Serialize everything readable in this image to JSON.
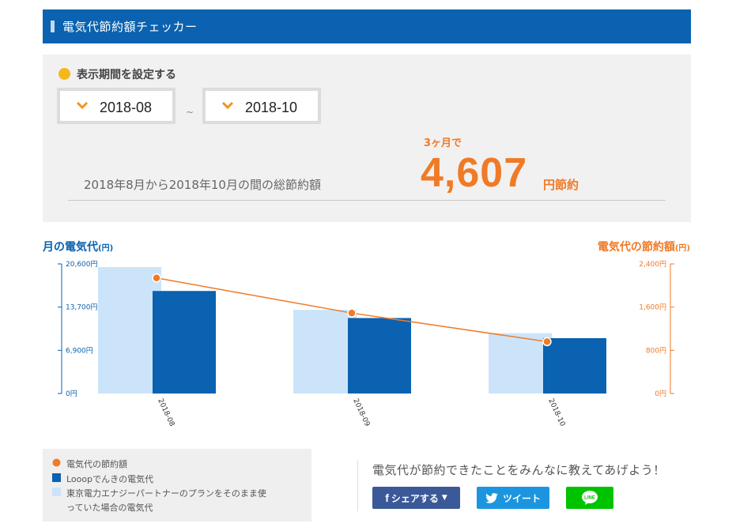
{
  "header": {
    "title": "電気代節約額チェッカー"
  },
  "period": {
    "label": "表示期間を設定する",
    "from": "2018-08",
    "separator": "~",
    "to": "2018-10"
  },
  "summary": {
    "description": "2018年8月から2018年10月の間の総節約額",
    "period_count": "3ヶ月で",
    "amount": "4,607",
    "amount_unit": "円節約"
  },
  "chart_titles": {
    "left": "月の電気代",
    "left_unit": "(円)",
    "right": "電気代の節約額",
    "right_unit": "(円)"
  },
  "chart_data": {
    "type": "bar",
    "categories": [
      "2018-08",
      "2018-09",
      "2018-10"
    ],
    "series": [
      {
        "name": "東京電力エナジーパートナーのプランをそのまま使っていた場合の電気代",
        "axis": "left",
        "color": "#cce4fa",
        "values": [
          20100,
          13300,
          9600
        ]
      },
      {
        "name": "Looopでんきの電気代",
        "axis": "left",
        "color": "#0a62b0",
        "values": [
          16300,
          12000,
          8800
        ]
      },
      {
        "name": "電気代の節約額",
        "axis": "right",
        "type": "line",
        "color": "#f07a26",
        "values": [
          2140,
          1490,
          960
        ]
      }
    ],
    "left_axis": {
      "ylim": [
        0,
        20600
      ],
      "ticks": [
        "20,600円",
        "13,700円",
        "6,900円",
        "0円"
      ],
      "color": "#0a62b0"
    },
    "right_axis": {
      "ylim": [
        0,
        2400
      ],
      "ticks": [
        "2,400円",
        "1,600円",
        "800円",
        "0円"
      ],
      "color": "#f07a26"
    }
  },
  "legend": {
    "items": [
      "電気代の節約額",
      "Looopでんきの電気代",
      "東京電力エナジーパートナーのプランをそのまま使",
      "っていた場合の電気代"
    ]
  },
  "share": {
    "message": "電気代が節約できたことをみんなに教えてあげよう！",
    "facebook": "シェアする",
    "facebook_icon": "facebook-f-icon",
    "twitter": "ツイート",
    "twitter_icon": "twitter-bird-icon",
    "line": "LINE",
    "colors": {
      "facebook": "#3b5998",
      "twitter": "#1b95e0",
      "line": "#00c300"
    }
  }
}
